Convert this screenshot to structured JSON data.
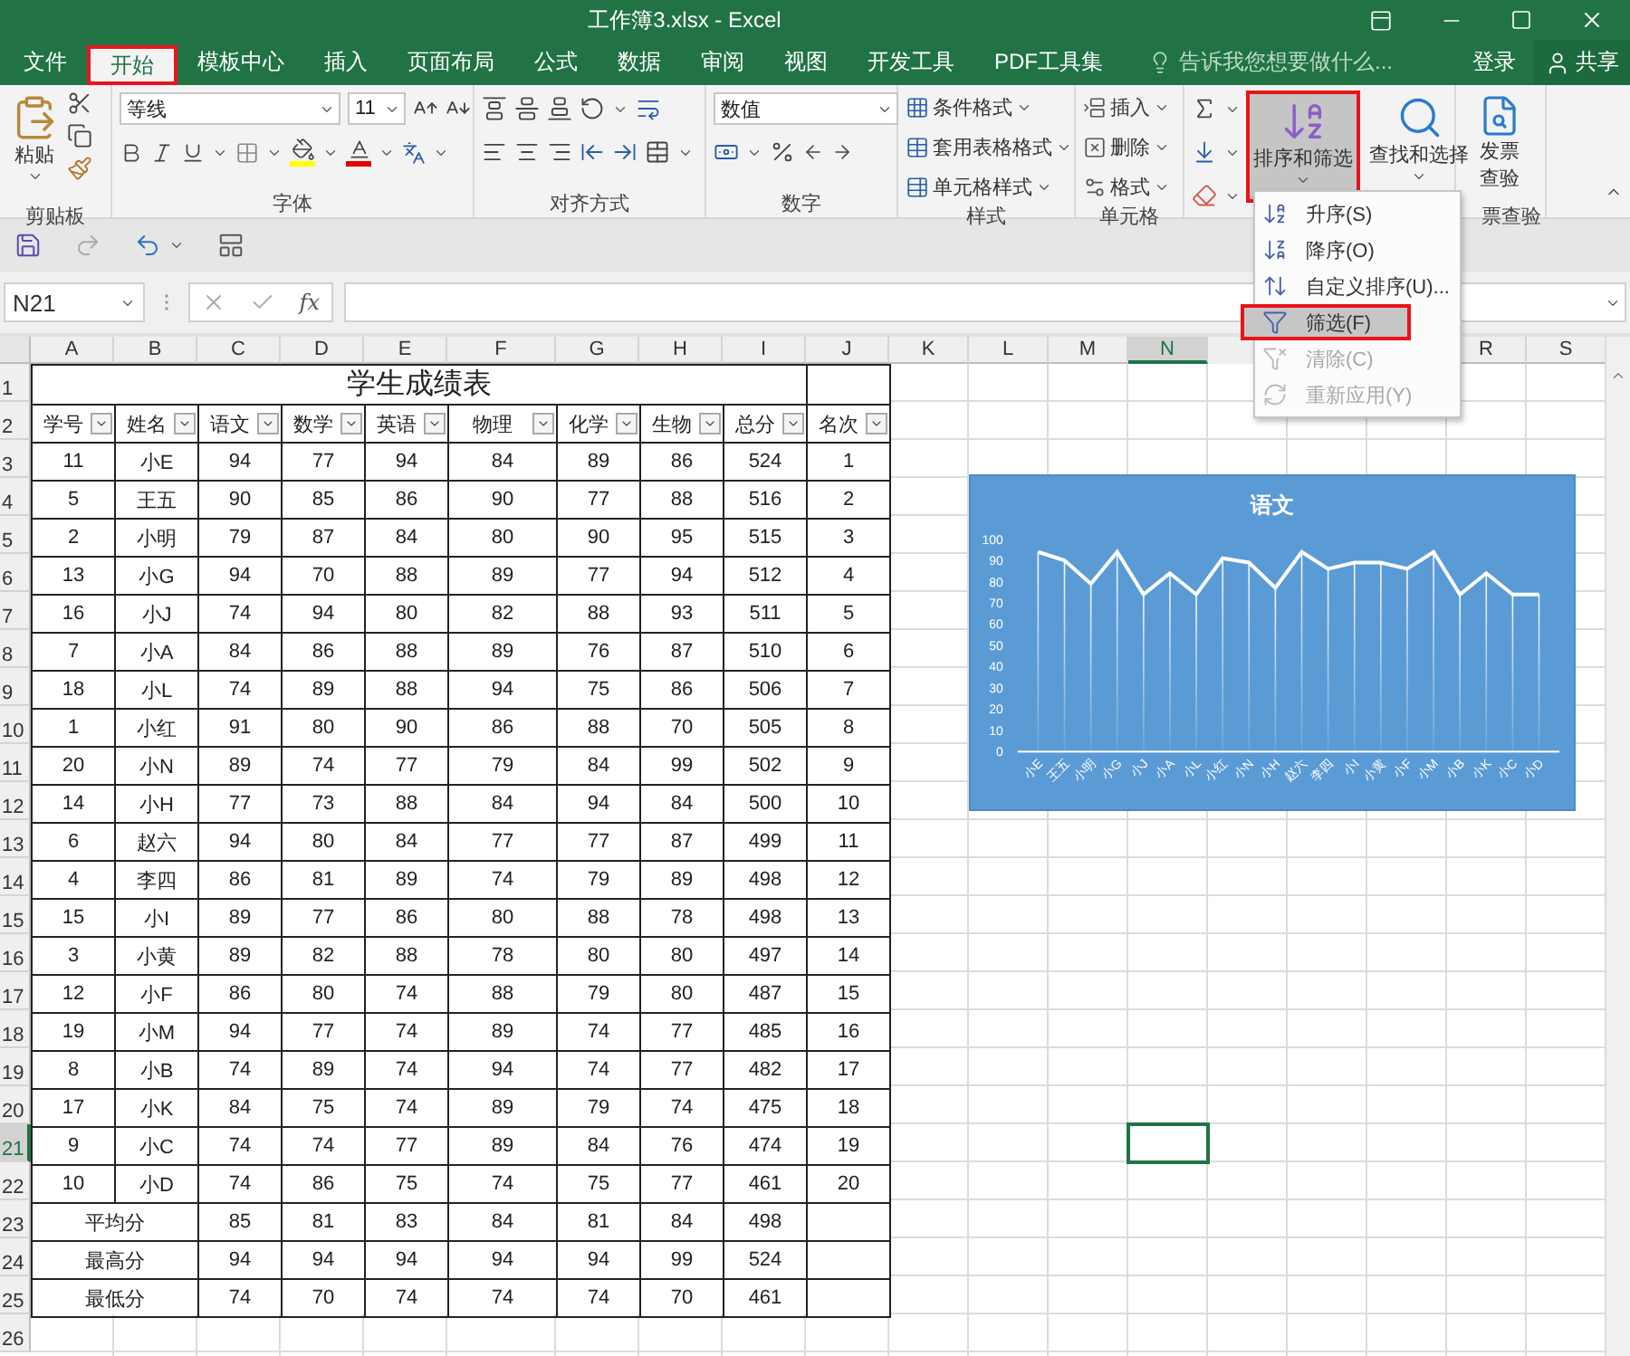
{
  "title_bar": {
    "title": "工作簿3.xlsx - Excel"
  },
  "tabs": [
    {
      "label": "文件",
      "selected": false,
      "annotated": false
    },
    {
      "label": "开始",
      "selected": true,
      "annotated": true
    },
    {
      "label": "模板中心",
      "selected": false,
      "annotated": false
    },
    {
      "label": "插入",
      "selected": false,
      "annotated": false
    },
    {
      "label": "页面布局",
      "selected": false,
      "annotated": false
    },
    {
      "label": "公式",
      "selected": false,
      "annotated": false
    },
    {
      "label": "数据",
      "selected": false,
      "annotated": false
    },
    {
      "label": "审阅",
      "selected": false,
      "annotated": false
    },
    {
      "label": "视图",
      "selected": false,
      "annotated": false
    },
    {
      "label": "开发工具",
      "selected": false,
      "annotated": false
    },
    {
      "label": "PDF工具集",
      "selected": false,
      "annotated": false
    }
  ],
  "tell_me": {
    "placeholder": "告诉我您想要做什么..."
  },
  "account": {
    "sign_in": "登录",
    "share": "共享"
  },
  "ribbon": {
    "groups": [
      {
        "kind": "clipboard",
        "label": "剪贴板",
        "paste": "粘贴"
      },
      {
        "kind": "font",
        "label": "字体",
        "font_name": "等线",
        "font_size": "11"
      },
      {
        "kind": "alignment",
        "label": "对齐方式"
      },
      {
        "kind": "number",
        "label": "数字",
        "format": "数值"
      },
      {
        "kind": "styles",
        "label": "样式",
        "buttons": [
          "条件格式",
          "套用表格格式",
          "单元格样式"
        ]
      },
      {
        "kind": "cells",
        "label": "单元格",
        "buttons": [
          "插入",
          "删除",
          "格式"
        ]
      },
      {
        "kind": "editing",
        "buttons": [
          {
            "label": "排序和筛选",
            "pressed": true,
            "annotated": true
          },
          {
            "label": "查找和选择",
            "pressed": false,
            "annotated": false
          }
        ]
      },
      {
        "kind": "invoice",
        "label": "票查验",
        "button": "发票查验"
      }
    ]
  },
  "sort_menu": {
    "items": [
      {
        "kind": "asc",
        "label": "升序(S)",
        "selected": false,
        "disabled": false,
        "annotated": false
      },
      {
        "kind": "desc",
        "label": "降序(O)",
        "selected": false,
        "disabled": false,
        "annotated": false
      },
      {
        "kind": "custom",
        "label": "自定义排序(U)...",
        "selected": false,
        "disabled": false,
        "annotated": false
      },
      {
        "kind": "filter",
        "label": "筛选(F)",
        "selected": true,
        "disabled": false,
        "annotated": true
      },
      {
        "kind": "clear",
        "label": "清除(C)",
        "selected": false,
        "disabled": true,
        "annotated": false
      },
      {
        "kind": "reapply",
        "label": "重新应用(Y)",
        "selected": false,
        "disabled": true,
        "annotated": false
      }
    ]
  },
  "formula_bar": {
    "name_box": "N21",
    "function_label": "fx"
  },
  "sheet": {
    "columns": [
      {
        "label": "A",
        "selected": false
      },
      {
        "label": "B",
        "selected": false
      },
      {
        "label": "C",
        "selected": false
      },
      {
        "label": "D",
        "selected": false
      },
      {
        "label": "E",
        "selected": false
      },
      {
        "label": "F",
        "selected": false
      },
      {
        "label": "G",
        "selected": false
      },
      {
        "label": "H",
        "selected": false
      },
      {
        "label": "I",
        "selected": false
      },
      {
        "label": "J",
        "selected": false
      },
      {
        "label": "K",
        "selected": false
      },
      {
        "label": "L",
        "selected": false
      },
      {
        "label": "M",
        "selected": false
      },
      {
        "label": "N",
        "selected": true
      },
      {
        "label": "R",
        "selected": false
      },
      {
        "label": "S",
        "selected": false
      }
    ],
    "rows": [
      {
        "label": "1",
        "selected": false
      },
      {
        "label": "2",
        "selected": false
      },
      {
        "label": "3",
        "selected": false
      },
      {
        "label": "4",
        "selected": false
      },
      {
        "label": "5",
        "selected": false
      },
      {
        "label": "6",
        "selected": false
      },
      {
        "label": "7",
        "selected": false
      },
      {
        "label": "8",
        "selected": false
      },
      {
        "label": "9",
        "selected": false
      },
      {
        "label": "10",
        "selected": false
      },
      {
        "label": "11",
        "selected": false
      },
      {
        "label": "12",
        "selected": false
      },
      {
        "label": "13",
        "selected": false
      },
      {
        "label": "14",
        "selected": false
      },
      {
        "label": "15",
        "selected": false
      },
      {
        "label": "16",
        "selected": false
      },
      {
        "label": "17",
        "selected": false
      },
      {
        "label": "18",
        "selected": false
      },
      {
        "label": "19",
        "selected": false
      },
      {
        "label": "20",
        "selected": false
      },
      {
        "label": "21",
        "selected": true
      },
      {
        "label": "22",
        "selected": false
      },
      {
        "label": "23",
        "selected": false
      },
      {
        "label": "24",
        "selected": false
      },
      {
        "label": "25",
        "selected": false
      },
      {
        "label": "26",
        "selected": false
      }
    ],
    "table": {
      "title": "学生成绩表",
      "headers": [
        "学号",
        "姓名",
        "语文",
        "数学",
        "英语",
        "物理",
        "化学",
        "生物",
        "总分",
        "名次"
      ],
      "rows": [
        [
          "11",
          "小E",
          "94",
          "77",
          "94",
          "84",
          "89",
          "86",
          "524",
          "1"
        ],
        [
          "5",
          "王五",
          "90",
          "85",
          "86",
          "90",
          "77",
          "88",
          "516",
          "2"
        ],
        [
          "2",
          "小明",
          "79",
          "87",
          "84",
          "80",
          "90",
          "95",
          "515",
          "3"
        ],
        [
          "13",
          "小G",
          "94",
          "70",
          "88",
          "89",
          "77",
          "94",
          "512",
          "4"
        ],
        [
          "16",
          "小J",
          "74",
          "94",
          "80",
          "82",
          "88",
          "93",
          "511",
          "5"
        ],
        [
          "7",
          "小A",
          "84",
          "86",
          "88",
          "89",
          "76",
          "87",
          "510",
          "6"
        ],
        [
          "18",
          "小L",
          "74",
          "89",
          "88",
          "94",
          "75",
          "86",
          "506",
          "7"
        ],
        [
          "1",
          "小红",
          "91",
          "80",
          "90",
          "86",
          "88",
          "70",
          "505",
          "8"
        ],
        [
          "20",
          "小N",
          "89",
          "74",
          "77",
          "79",
          "84",
          "99",
          "502",
          "9"
        ],
        [
          "14",
          "小H",
          "77",
          "73",
          "88",
          "84",
          "94",
          "84",
          "500",
          "10"
        ],
        [
          "6",
          "赵六",
          "94",
          "80",
          "84",
          "77",
          "77",
          "87",
          "499",
          "11"
        ],
        [
          "4",
          "李四",
          "86",
          "81",
          "89",
          "74",
          "79",
          "89",
          "498",
          "12"
        ],
        [
          "15",
          "小I",
          "89",
          "77",
          "86",
          "80",
          "88",
          "78",
          "498",
          "13"
        ],
        [
          "3",
          "小黄",
          "89",
          "82",
          "88",
          "78",
          "80",
          "80",
          "497",
          "14"
        ],
        [
          "12",
          "小F",
          "86",
          "80",
          "74",
          "88",
          "79",
          "80",
          "487",
          "15"
        ],
        [
          "19",
          "小M",
          "94",
          "77",
          "74",
          "89",
          "74",
          "77",
          "485",
          "16"
        ],
        [
          "8",
          "小B",
          "74",
          "89",
          "74",
          "94",
          "74",
          "77",
          "482",
          "17"
        ],
        [
          "17",
          "小K",
          "84",
          "75",
          "74",
          "89",
          "79",
          "74",
          "475",
          "18"
        ],
        [
          "9",
          "小C",
          "74",
          "74",
          "77",
          "89",
          "84",
          "76",
          "474",
          "19"
        ],
        [
          "10",
          "小D",
          "74",
          "86",
          "75",
          "74",
          "75",
          "77",
          "461",
          "20"
        ]
      ],
      "summary": [
        {
          "label": "平均分",
          "values": [
            "85",
            "81",
            "83",
            "84",
            "81",
            "84",
            "498"
          ]
        },
        {
          "label": "最高分",
          "values": [
            "94",
            "94",
            "94",
            "94",
            "94",
            "99",
            "524"
          ]
        },
        {
          "label": "最低分",
          "values": [
            "74",
            "70",
            "74",
            "74",
            "74",
            "70",
            "461"
          ]
        }
      ]
    },
    "chart_data": {
      "type": "line",
      "title": "语文",
      "categories": [
        "小E",
        "王五",
        "小明",
        "小G",
        "小J",
        "小A",
        "小L",
        "小红",
        "小N",
        "小H",
        "赵六",
        "李四",
        "小I",
        "小黄",
        "小F",
        "小M",
        "小B",
        "小K",
        "小C",
        "小D"
      ],
      "series": [
        {
          "color": "#ffffff",
          "values": [
            94,
            90,
            79,
            94,
            74,
            84,
            74,
            91,
            89,
            77,
            94,
            86,
            89,
            89,
            86,
            94,
            74,
            84,
            74,
            74
          ]
        }
      ],
      "ylim": [
        0,
        100
      ],
      "yticks": [
        0,
        10,
        20,
        30,
        40,
        50,
        60,
        70,
        80,
        90,
        100
      ]
    }
  }
}
